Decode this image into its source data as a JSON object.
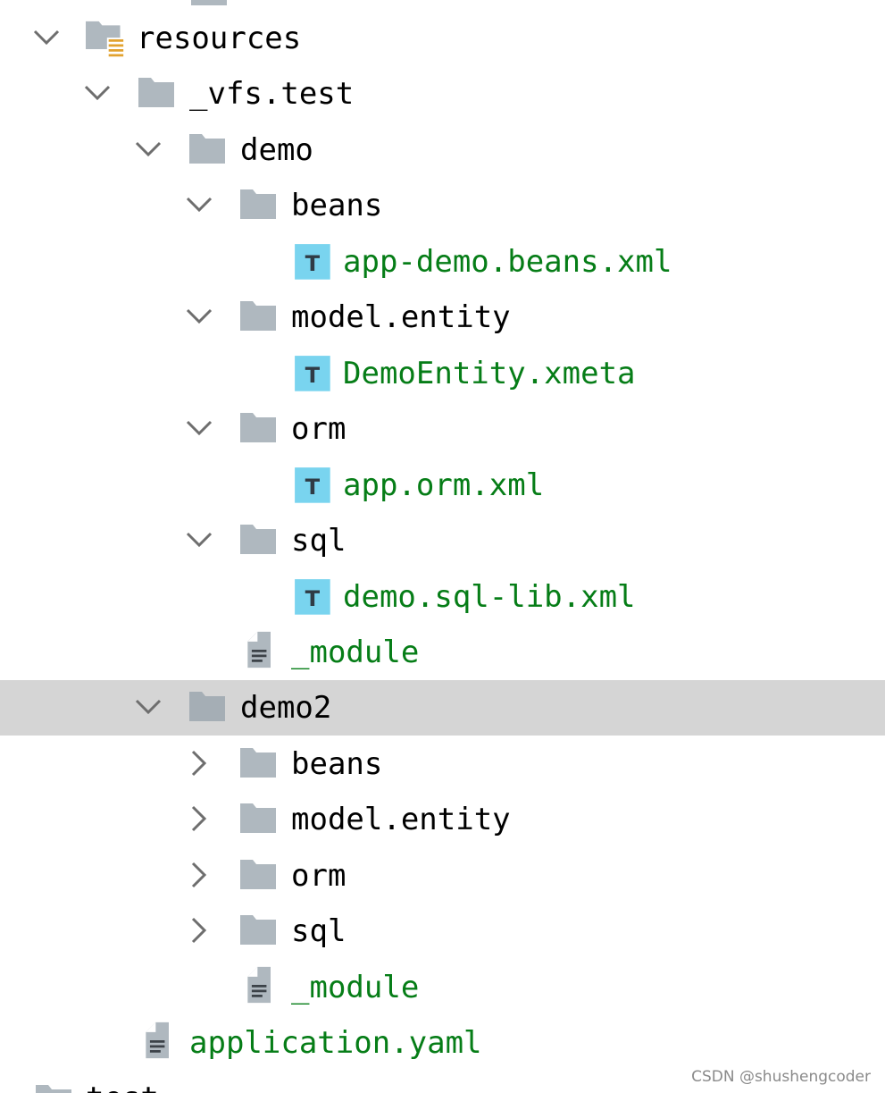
{
  "tree": {
    "resources": {
      "label": "resources"
    },
    "vfs_test": {
      "label": "_vfs.test"
    },
    "demo": {
      "label": "demo"
    },
    "demo_beans": {
      "label": "beans"
    },
    "app_demo_beans": {
      "label": "app-demo.beans.xml"
    },
    "demo_model_entity": {
      "label": "model.entity"
    },
    "demo_entity_xmeta": {
      "label": "DemoEntity.xmeta"
    },
    "demo_orm": {
      "label": "orm"
    },
    "app_orm": {
      "label": "app.orm.xml"
    },
    "demo_sql": {
      "label": "sql"
    },
    "demo_sql_lib": {
      "label": "demo.sql-lib.xml"
    },
    "demo_module": {
      "label": "_module"
    },
    "demo2": {
      "label": "demo2"
    },
    "demo2_beans": {
      "label": "beans"
    },
    "demo2_model_entity": {
      "label": "model.entity"
    },
    "demo2_orm": {
      "label": "orm"
    },
    "demo2_sql": {
      "label": "sql"
    },
    "demo2_module": {
      "label": "_module"
    },
    "application_yaml": {
      "label": "application.yaml"
    },
    "partial_bottom": {
      "label": "test"
    }
  },
  "watermark": "CSDN @shushengcoder",
  "colors": {
    "folder": "#afb8bf",
    "file_text": "#067d17",
    "text_file_icon": "#79d4ef",
    "selection": "#d5d5d5",
    "resource_lines": "#e2a22f"
  },
  "icons": {
    "expanded": "chevron-down-icon",
    "collapsed": "chevron-right-icon",
    "folder": "folder-icon",
    "resources_folder": "resources-folder-icon",
    "template_file": "text-template-file-icon",
    "plain_file": "plain-file-icon"
  }
}
